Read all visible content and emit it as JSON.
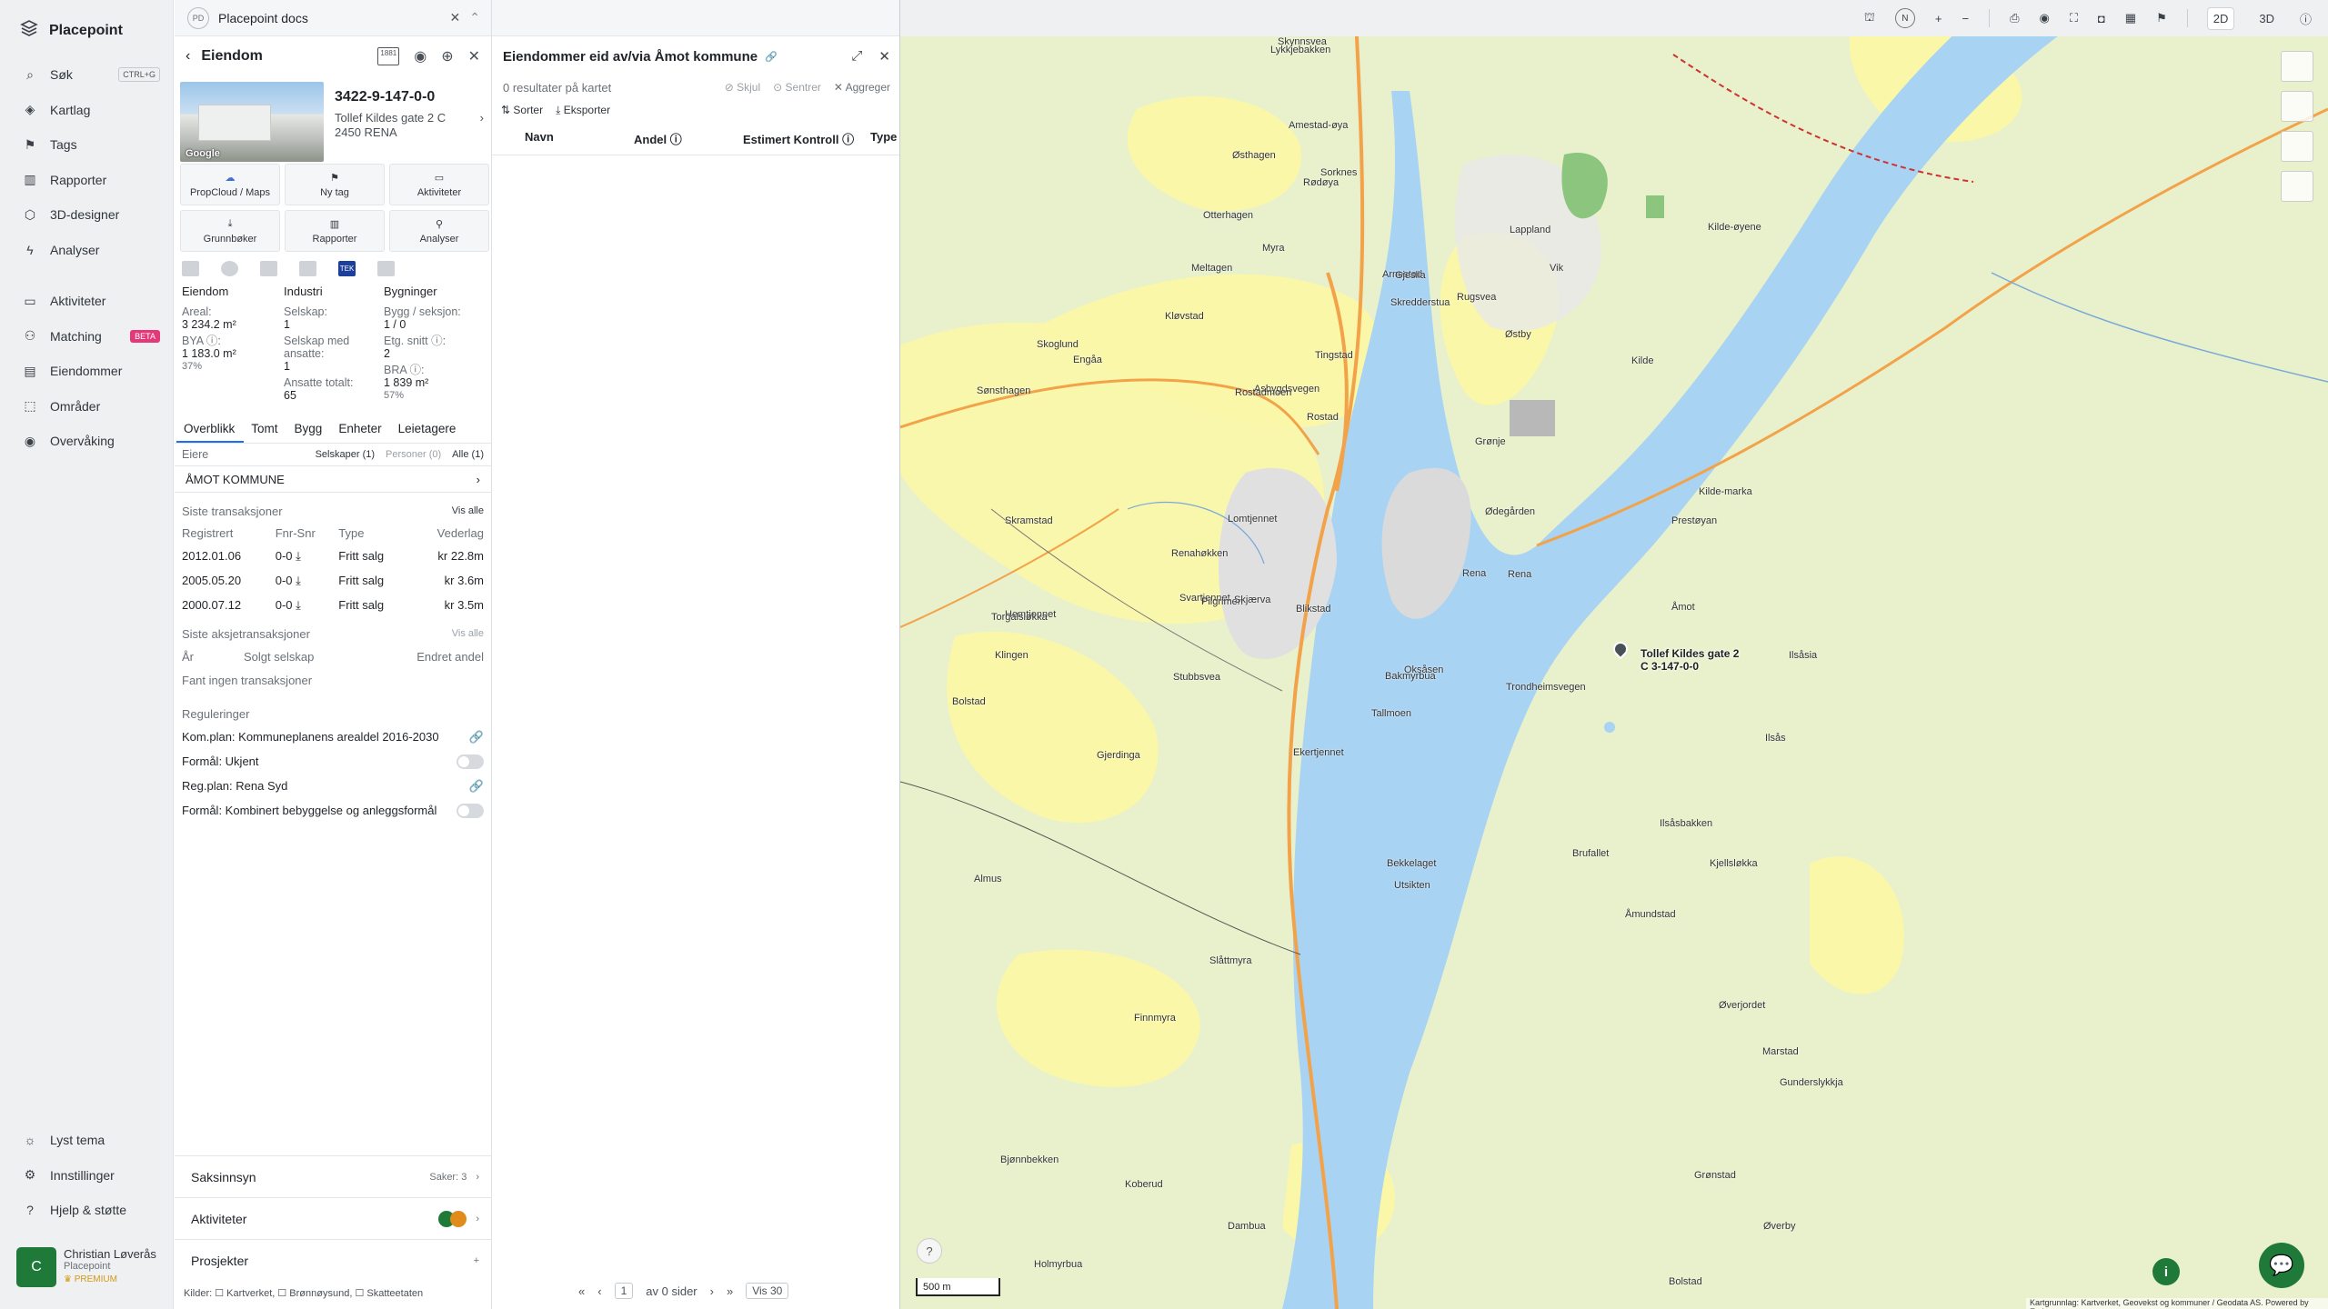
{
  "sidebar": {
    "brand": "Placepoint",
    "items": [
      {
        "label": "Søk",
        "icon": "search-icon",
        "kbd": "CTRL+G"
      },
      {
        "label": "Kartlag",
        "icon": "layers-icon"
      },
      {
        "label": "Tags",
        "icon": "bookmark-icon"
      },
      {
        "label": "Rapporter",
        "icon": "chart-icon"
      },
      {
        "label": "3D-designer",
        "icon": "cube-icon"
      },
      {
        "label": "Analyser",
        "icon": "bolt-icon"
      }
    ],
    "items2": [
      {
        "label": "Aktiviteter",
        "icon": "chat-icon"
      },
      {
        "label": "Matching",
        "icon": "handshake-icon",
        "badge": "BETA"
      },
      {
        "label": "Eiendommer",
        "icon": "building-icon"
      },
      {
        "label": "Områder",
        "icon": "area-icon"
      },
      {
        "label": "Overvåking",
        "icon": "eye-icon"
      }
    ],
    "bottom": [
      {
        "label": "Lyst tema",
        "icon": "sun-icon"
      },
      {
        "label": "Innstillinger",
        "icon": "gear-icon"
      },
      {
        "label": "Hjelp & støtte",
        "icon": "help-icon"
      }
    ],
    "user": {
      "initial": "C",
      "name": "Christian Løverås",
      "org": "Placepoint",
      "plan": "PREMIUM"
    }
  },
  "property": {
    "tab_badge": "PD",
    "tab_title": "Placepoint docs",
    "header": "Eiendom",
    "header_badge": "1881",
    "photo_credit": "Google",
    "id": "3422-9-147-0-0",
    "address1": "Tollef Kildes gate 2 C",
    "address2": "2450 RENA",
    "buttons": [
      "PropCloud / Maps",
      "Ny tag",
      "Aktiviteter",
      "Grunnbøker",
      "Rapporter",
      "Analyser"
    ],
    "src_tek": "TEK",
    "stats": {
      "col1_h": "Eiendom",
      "areal_l": "Areal:",
      "areal_v": "3 234.2 m²",
      "bya_l": "BYA ⓘ:",
      "bya_v": "1 183.0 m²",
      "bya_p": "37%",
      "col2_h": "Industri",
      "selskap_l": "Selskap:",
      "selskap_v": "1",
      "ansatte_l": "Selskap med ansatte:",
      "ansatte_v": "1",
      "ansatte_tot_l": "Ansatte totalt:",
      "ansatte_tot_v": "65",
      "col3_h": "Bygninger",
      "bygg_l": "Bygg / seksjon:",
      "bygg_v": "1 / 0",
      "etg_l": "Etg. snitt ⓘ:",
      "etg_v": "2",
      "bra_l": "BRA ⓘ:",
      "bra_v": "1 839 m²",
      "bra_p": "57%"
    },
    "tabs": [
      "Overblikk",
      "Tomt",
      "Bygg",
      "Enheter",
      "Leietagere"
    ],
    "eiere_label": "Eiere",
    "eiere_filters": [
      "Selskaper (1)",
      "Personer (0)",
      "Alle (1)"
    ],
    "owner": "ÅMOT KOMMUNE",
    "tx_title": "Siste transaksjoner",
    "tx_all": "Vis alle",
    "tx_headers": [
      "Registrert",
      "Fnr-Snr",
      "Type",
      "Vederlag"
    ],
    "tx_rows": [
      {
        "date": "2012.01.06",
        "fnr": "0-0",
        "type": "Fritt salg",
        "amount": "kr 22.8m"
      },
      {
        "date": "2005.05.20",
        "fnr": "0-0",
        "type": "Fritt salg",
        "amount": "kr 3.6m"
      },
      {
        "date": "2000.07.12",
        "fnr": "0-0",
        "type": "Fritt salg",
        "amount": "kr 3.5m"
      }
    ],
    "aksje_title": "Siste aksjetransaksjoner",
    "aksje_all": "Vis alle",
    "aksje_headers": [
      "År",
      "Solgt selskap",
      "Endret andel"
    ],
    "aksje_none": "Fant ingen transaksjoner",
    "reg_title": "Reguleringer",
    "reg_rows": [
      "Kom.plan: Kommuneplanens arealdel 2016-2030",
      "Formål: Ukjent",
      "Reg.plan: Rena Syd",
      "Formål: Kombinert bebyggelse og anleggsformål"
    ],
    "acc": [
      {
        "label": "Saksinnsyn",
        "extra": "Saker: 3"
      },
      {
        "label": "Aktiviteter",
        "extra": ""
      },
      {
        "label": "Prosjekter",
        "extra": "+"
      }
    ],
    "kilder": "Kilder: ☐ Kartverket, ☐ Brønnøysund, ☐ Skatteetaten"
  },
  "list": {
    "title": "Eiendommer eid av/via Åmot kommune",
    "results": "0 resultater på kartet",
    "skjul": "Skjul",
    "sentrer": "Sentrer",
    "aggreger": "Aggreger",
    "sorter": "Sorter",
    "eksporter": "Eksporter",
    "columns": [
      "Navn",
      "Andel ⓘ",
      "Estimert Kontroll ⓘ",
      "Type"
    ],
    "pager_page": "1",
    "pager_of": "av 0 sider",
    "pager_show": "Vis 30"
  },
  "map": {
    "toolbar": [
      "2D",
      "3D"
    ],
    "scale": "500 m",
    "pin_label": "Tollef Kildes gate 2 C 3-147-0-0",
    "attribution": "Kartgrunnlag: Kartverket, Geovekst og kommuner / Geodata AS. Powered by Esri",
    "places": [
      {
        "name": "Skynnsvea"
      },
      {
        "name": "Sorknes"
      },
      {
        "name": "Rødøya"
      },
      {
        "name": "Amestad-øya"
      },
      {
        "name": "Myra"
      },
      {
        "name": "Lappland"
      },
      {
        "name": "Kløvstad"
      },
      {
        "name": "Arnestad"
      },
      {
        "name": "Rugsvea"
      },
      {
        "name": "Skoglund"
      },
      {
        "name": "Tingstad"
      },
      {
        "name": "Østby"
      },
      {
        "name": "Asbygdsvegen"
      },
      {
        "name": "Rostadmoen"
      },
      {
        "name": "Rostad"
      },
      {
        "name": "Grønje"
      },
      {
        "name": "Skramstad"
      },
      {
        "name": "Ødegården"
      },
      {
        "name": "Rena"
      },
      {
        "name": "Åmot"
      },
      {
        "name": "Prestøyan"
      },
      {
        "name": "Torgalsløkka"
      },
      {
        "name": "Blikstad"
      },
      {
        "name": "Klingen"
      },
      {
        "name": "Stubbsvea"
      },
      {
        "name": "Bolstad"
      },
      {
        "name": "Tallmoen"
      },
      {
        "name": "Gjerdinga"
      },
      {
        "name": "Bekkelaget"
      },
      {
        "name": "Almus"
      },
      {
        "name": "Slåttmyra"
      },
      {
        "name": "Finnmyra"
      },
      {
        "name": "Dambua"
      },
      {
        "name": "Holmyrbua"
      },
      {
        "name": "Koberud"
      },
      {
        "name": "Brufallet"
      },
      {
        "name": "Ilsåsbakken"
      },
      {
        "name": "Ilsåsia"
      },
      {
        "name": "Ilsås"
      },
      {
        "name": "Kjellsløkka"
      },
      {
        "name": "Hemtjennet"
      },
      {
        "name": "Svartjennet"
      },
      {
        "name": "Oksåsen"
      },
      {
        "name": "Bakmyrbua"
      },
      {
        "name": "Ekertjennet"
      },
      {
        "name": "Utsikten"
      },
      {
        "name": "Pilgrimen"
      },
      {
        "name": "Renahøkken"
      },
      {
        "name": "Lomtjennet"
      },
      {
        "name": "Kilde"
      },
      {
        "name": "Kilde-marka"
      },
      {
        "name": "Sønsthagen"
      },
      {
        "name": "Skredderstua"
      },
      {
        "name": "Otterhagen"
      },
      {
        "name": "Meltagen"
      },
      {
        "name": "Østhagen"
      },
      {
        "name": "Lykkjebakken"
      },
      {
        "name": "Gjeslia"
      },
      {
        "name": "Marstad"
      },
      {
        "name": "Gunderslykkja"
      },
      {
        "name": "Øverjordet"
      },
      {
        "name": "Grønstad"
      },
      {
        "name": "Øverby"
      },
      {
        "name": "Bolstad"
      },
      {
        "name": "Åmundstad"
      },
      {
        "name": "Vik"
      },
      {
        "name": "Kilde-øyene"
      },
      {
        "name": "Trondheimsvegen"
      },
      {
        "name": "Skjærva"
      },
      {
        "name": "Engåa"
      },
      {
        "name": "Bjønnbekken"
      },
      {
        "name": "Rena"
      }
    ]
  },
  "colors": {
    "accent": "#1f7a3a",
    "beta": "#e3387a",
    "premium": "#d49a17"
  }
}
